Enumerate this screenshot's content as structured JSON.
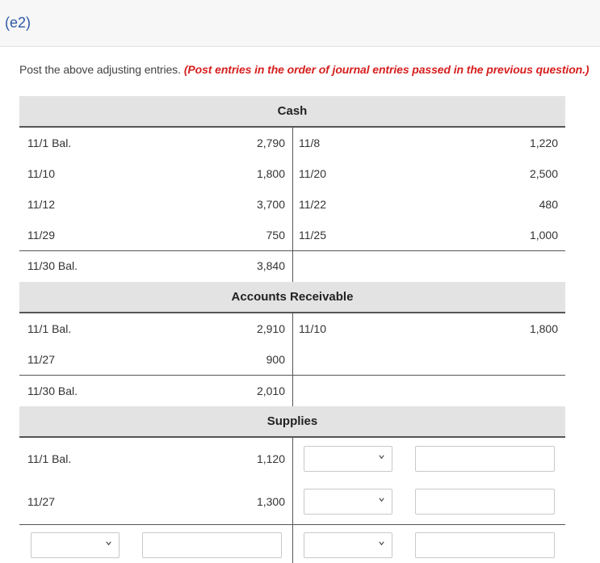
{
  "header": {
    "label": "(e2)"
  },
  "instruction": {
    "text": "Post the above adjusting entries.",
    "note": "(Post entries in the order of journal entries passed in the previous question.)"
  },
  "accounts": {
    "cash": {
      "title": "Cash",
      "rows": [
        {
          "ldate": "11/1 Bal.",
          "lamt": "2,790",
          "rdate": "11/8",
          "ramt": "1,220"
        },
        {
          "ldate": "11/10",
          "lamt": "1,800",
          "rdate": "11/20",
          "ramt": "2,500"
        },
        {
          "ldate": "11/12",
          "lamt": "3,700",
          "rdate": "11/22",
          "ramt": "480"
        },
        {
          "ldate": "11/29",
          "lamt": "750",
          "rdate": "11/25",
          "ramt": "1,000"
        }
      ],
      "balance": {
        "ldate": "11/30 Bal.",
        "lamt": "3,840"
      }
    },
    "ar": {
      "title": "Accounts Receivable",
      "rows": [
        {
          "ldate": "11/1 Bal.",
          "lamt": "2,910",
          "rdate": "11/10",
          "ramt": "1,800"
        },
        {
          "ldate": "11/27",
          "lamt": "900"
        }
      ],
      "balance": {
        "ldate": "11/30 Bal.",
        "lamt": "2,010"
      }
    },
    "supplies": {
      "title": "Supplies",
      "rows": [
        {
          "ldate": "11/1 Bal.",
          "lamt": "1,120",
          "rdate_value": "",
          "ramt_value": ""
        },
        {
          "ldate": "11/27",
          "lamt": "1,300",
          "rdate_value": "",
          "ramt_value": ""
        }
      ],
      "balance": {
        "ldate_value": "",
        "lamt_value": "",
        "rdate_value": "",
        "ramt_value": ""
      }
    }
  }
}
